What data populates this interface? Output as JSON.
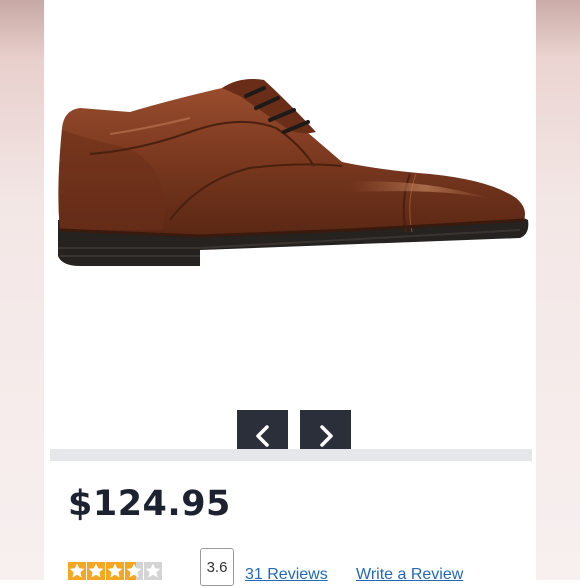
{
  "product": {
    "price": "$124.95",
    "image_alt": "brown-leather-cap-toe-oxford-shoe"
  },
  "gallery": {
    "prev_icon": "chevron-left-icon",
    "next_icon": "chevron-right-icon",
    "button_color": "#2b2f3a"
  },
  "rating": {
    "value": 3.6,
    "display": "3.6",
    "star_count": 5,
    "star_color": "#f5a623",
    "reviews_label": "31 Reviews",
    "write_label": "Write a Review"
  },
  "colors": {
    "price_text": "#1c2230",
    "link": "#2469b8",
    "leather": "#7a3a22"
  }
}
